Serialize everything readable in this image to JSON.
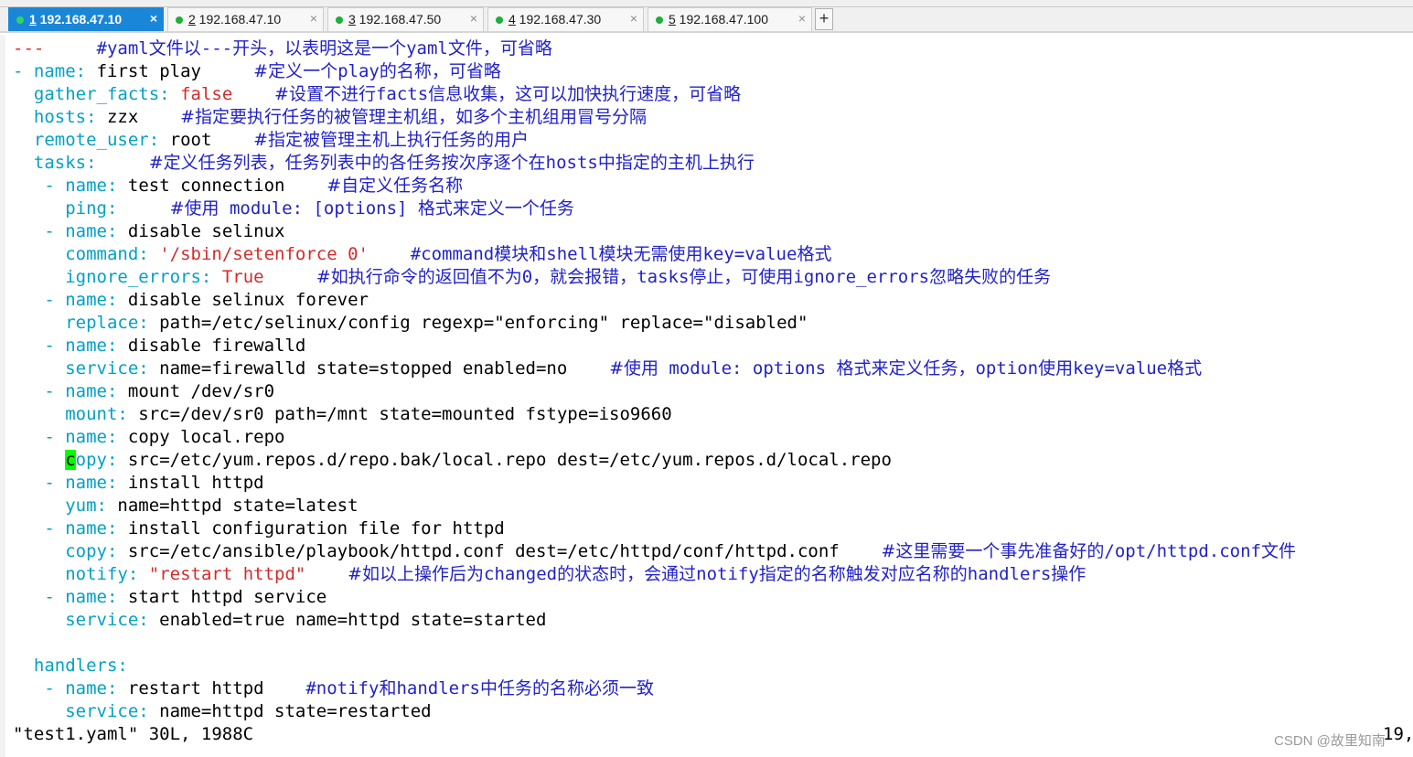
{
  "tabs": [
    {
      "num": "1",
      "host": "192.168.47.10",
      "active": true
    },
    {
      "num": "2",
      "host": "192.168.47.10",
      "active": false
    },
    {
      "num": "3",
      "host": "192.168.47.50",
      "active": false
    },
    {
      "num": "4",
      "host": "192.168.47.30",
      "active": false
    },
    {
      "num": "5",
      "host": "192.168.47.100",
      "active": false
    }
  ],
  "add_tab_label": "+",
  "close_glyph": "×",
  "lines": [
    [
      {
        "t": "---",
        "c": "s"
      },
      {
        "t": "     "
      },
      {
        "t": "#yaml",
        "c": "c"
      },
      {
        "t": "文件以",
        "c": "cz"
      },
      {
        "t": "---",
        "c": "c"
      },
      {
        "t": "开头，以表明这是一个",
        "c": "cz"
      },
      {
        "t": "yaml",
        "c": "c"
      },
      {
        "t": "文件，可省略",
        "c": "cz"
      }
    ],
    [
      {
        "t": "-",
        "c": "d"
      },
      {
        "t": " "
      },
      {
        "t": "name",
        "c": "k"
      },
      {
        "t": ":",
        "c": "d"
      },
      {
        "t": " first play     "
      },
      {
        "t": "#定义一个",
        "c": "cz"
      },
      {
        "t": "play",
        "c": "c"
      },
      {
        "t": "的名称，可省略",
        "c": "cz"
      }
    ],
    [
      {
        "t": "  "
      },
      {
        "t": "gather_facts",
        "c": "k"
      },
      {
        "t": ":",
        "c": "d"
      },
      {
        "t": " "
      },
      {
        "t": "false",
        "c": "s"
      },
      {
        "t": "    "
      },
      {
        "t": "#设置不进行",
        "c": "cz"
      },
      {
        "t": "facts",
        "c": "c"
      },
      {
        "t": "信息收集，这可以加快执行速度，可省略",
        "c": "cz"
      }
    ],
    [
      {
        "t": "  "
      },
      {
        "t": "hosts",
        "c": "k"
      },
      {
        "t": ":",
        "c": "d"
      },
      {
        "t": " zzx    "
      },
      {
        "t": "#指定要执行任务的被管理主机组，如多个主机组用冒号分隔",
        "c": "cz"
      }
    ],
    [
      {
        "t": "  "
      },
      {
        "t": "remote_user",
        "c": "k"
      },
      {
        "t": ":",
        "c": "d"
      },
      {
        "t": " root    "
      },
      {
        "t": "#指定被管理主机上执行任务的用户",
        "c": "cz"
      }
    ],
    [
      {
        "t": "  "
      },
      {
        "t": "tasks",
        "c": "k"
      },
      {
        "t": ":",
        "c": "d"
      },
      {
        "t": "     "
      },
      {
        "t": "#定义任务列表，任务列表中的各任务按次序逐个在",
        "c": "cz"
      },
      {
        "t": "hosts",
        "c": "c"
      },
      {
        "t": "中指定的主机上执行",
        "c": "cz"
      }
    ],
    [
      {
        "t": "   "
      },
      {
        "t": "-",
        "c": "d"
      },
      {
        "t": " "
      },
      {
        "t": "name",
        "c": "k"
      },
      {
        "t": ":",
        "c": "d"
      },
      {
        "t": " test connection    "
      },
      {
        "t": "#自定义任务名称",
        "c": "cz"
      }
    ],
    [
      {
        "t": "     "
      },
      {
        "t": "ping",
        "c": "k"
      },
      {
        "t": ":",
        "c": "d"
      },
      {
        "t": "     "
      },
      {
        "t": "#使用",
        "c": "cz"
      },
      {
        "t": " module: [options] ",
        "c": "c"
      },
      {
        "t": "格式来定义一个任务",
        "c": "cz"
      }
    ],
    [
      {
        "t": "   "
      },
      {
        "t": "-",
        "c": "d"
      },
      {
        "t": " "
      },
      {
        "t": "name",
        "c": "k"
      },
      {
        "t": ":",
        "c": "d"
      },
      {
        "t": " disable selinux"
      }
    ],
    [
      {
        "t": "     "
      },
      {
        "t": "command",
        "c": "k"
      },
      {
        "t": ":",
        "c": "d"
      },
      {
        "t": " "
      },
      {
        "t": "'/sbin/setenforce 0'",
        "c": "s"
      },
      {
        "t": "    "
      },
      {
        "t": "#command",
        "c": "c"
      },
      {
        "t": "模块和",
        "c": "cz"
      },
      {
        "t": "shell",
        "c": "c"
      },
      {
        "t": "模块无需使用",
        "c": "cz"
      },
      {
        "t": "key=value",
        "c": "c"
      },
      {
        "t": "格式",
        "c": "cz"
      }
    ],
    [
      {
        "t": "     "
      },
      {
        "t": "ignore_errors",
        "c": "k"
      },
      {
        "t": ":",
        "c": "d"
      },
      {
        "t": " "
      },
      {
        "t": "True",
        "c": "s"
      },
      {
        "t": "     "
      },
      {
        "t": "#如执行命令的返回值不为",
        "c": "cz"
      },
      {
        "t": "0",
        "c": "c"
      },
      {
        "t": "，就会报错，",
        "c": "cz"
      },
      {
        "t": "tasks",
        "c": "c"
      },
      {
        "t": "停止，可使用",
        "c": "cz"
      },
      {
        "t": "ignore_errors",
        "c": "c"
      },
      {
        "t": "忽略失败的任务",
        "c": "cz"
      }
    ],
    [
      {
        "t": "   "
      },
      {
        "t": "-",
        "c": "d"
      },
      {
        "t": " "
      },
      {
        "t": "name",
        "c": "k"
      },
      {
        "t": ":",
        "c": "d"
      },
      {
        "t": " disable selinux forever"
      }
    ],
    [
      {
        "t": "     "
      },
      {
        "t": "replace",
        "c": "k"
      },
      {
        "t": ":",
        "c": "d"
      },
      {
        "t": " path=/etc/selinux/config regexp=\"enforcing\" replace=\"disabled\""
      }
    ],
    [
      {
        "t": "   "
      },
      {
        "t": "-",
        "c": "d"
      },
      {
        "t": " "
      },
      {
        "t": "name",
        "c": "k"
      },
      {
        "t": ":",
        "c": "d"
      },
      {
        "t": " disable firewalld"
      }
    ],
    [
      {
        "t": "     "
      },
      {
        "t": "service",
        "c": "k"
      },
      {
        "t": ":",
        "c": "d"
      },
      {
        "t": " name=firewalld state=stopped enabled=no    "
      },
      {
        "t": "#使用",
        "c": "cz"
      },
      {
        "t": " module: options ",
        "c": "c"
      },
      {
        "t": "格式来定义任务，",
        "c": "cz"
      },
      {
        "t": "option",
        "c": "c"
      },
      {
        "t": "使用",
        "c": "cz"
      },
      {
        "t": "key=value",
        "c": "c"
      },
      {
        "t": "格式",
        "c": "cz"
      }
    ],
    [
      {
        "t": "   "
      },
      {
        "t": "-",
        "c": "d"
      },
      {
        "t": " "
      },
      {
        "t": "name",
        "c": "k"
      },
      {
        "t": ":",
        "c": "d"
      },
      {
        "t": " mount /dev/sr0"
      }
    ],
    [
      {
        "t": "     "
      },
      {
        "t": "mount",
        "c": "k"
      },
      {
        "t": ":",
        "c": "d"
      },
      {
        "t": " src=/dev/sr0 path=/mnt state=mounted fstype=iso9660"
      }
    ],
    [
      {
        "t": "   "
      },
      {
        "t": "-",
        "c": "d"
      },
      {
        "t": " "
      },
      {
        "t": "name",
        "c": "k"
      },
      {
        "t": ":",
        "c": "d"
      },
      {
        "t": " copy local.repo"
      }
    ],
    [
      {
        "t": "     "
      },
      {
        "t": "c",
        "c": "cur"
      },
      {
        "t": "opy",
        "c": "k"
      },
      {
        "t": ":",
        "c": "d"
      },
      {
        "t": " src=/etc/yum.repos.d/repo.bak/local.repo dest=/etc/yum.repos.d/local.repo"
      }
    ],
    [
      {
        "t": "   "
      },
      {
        "t": "-",
        "c": "d"
      },
      {
        "t": " "
      },
      {
        "t": "name",
        "c": "k"
      },
      {
        "t": ":",
        "c": "d"
      },
      {
        "t": " install httpd"
      }
    ],
    [
      {
        "t": "     "
      },
      {
        "t": "yum",
        "c": "k"
      },
      {
        "t": ":",
        "c": "d"
      },
      {
        "t": " name=httpd state=latest"
      }
    ],
    [
      {
        "t": "   "
      },
      {
        "t": "-",
        "c": "d"
      },
      {
        "t": " "
      },
      {
        "t": "name",
        "c": "k"
      },
      {
        "t": ":",
        "c": "d"
      },
      {
        "t": " install configuration file for httpd"
      }
    ],
    [
      {
        "t": "     "
      },
      {
        "t": "copy",
        "c": "k"
      },
      {
        "t": ":",
        "c": "d"
      },
      {
        "t": " src=/etc/ansible/playbook/httpd.conf dest=/etc/httpd/conf/httpd.conf    "
      },
      {
        "t": "#这里需要一个事先准备好的",
        "c": "cz"
      },
      {
        "t": "/opt/httpd.conf",
        "c": "c"
      },
      {
        "t": "文件",
        "c": "cz"
      }
    ],
    [
      {
        "t": "     "
      },
      {
        "t": "notify",
        "c": "k"
      },
      {
        "t": ":",
        "c": "d"
      },
      {
        "t": " "
      },
      {
        "t": "\"restart httpd\"",
        "c": "s"
      },
      {
        "t": "    "
      },
      {
        "t": "#如以上操作后为",
        "c": "cz"
      },
      {
        "t": "changed",
        "c": "c"
      },
      {
        "t": "的状态时，会通过",
        "c": "cz"
      },
      {
        "t": "notify",
        "c": "c"
      },
      {
        "t": "指定的名称触发对应名称的",
        "c": "cz"
      },
      {
        "t": "handlers",
        "c": "c"
      },
      {
        "t": "操作",
        "c": "cz"
      }
    ],
    [
      {
        "t": "   "
      },
      {
        "t": "-",
        "c": "d"
      },
      {
        "t": " "
      },
      {
        "t": "name",
        "c": "k"
      },
      {
        "t": ":",
        "c": "d"
      },
      {
        "t": " start httpd service"
      }
    ],
    [
      {
        "t": "     "
      },
      {
        "t": "service",
        "c": "k"
      },
      {
        "t": ":",
        "c": "d"
      },
      {
        "t": " enabled=true name=httpd state=started"
      }
    ],
    [
      {
        "t": ""
      }
    ],
    [
      {
        "t": "  "
      },
      {
        "t": "handlers",
        "c": "k"
      },
      {
        "t": ":",
        "c": "d"
      }
    ],
    [
      {
        "t": "   "
      },
      {
        "t": "-",
        "c": "d"
      },
      {
        "t": " "
      },
      {
        "t": "name",
        "c": "k"
      },
      {
        "t": ":",
        "c": "d"
      },
      {
        "t": " restart httpd    "
      },
      {
        "t": "#notify",
        "c": "c"
      },
      {
        "t": "和",
        "c": "cz"
      },
      {
        "t": "handlers",
        "c": "c"
      },
      {
        "t": "中任务的名称必须一致",
        "c": "cz"
      }
    ],
    [
      {
        "t": "     "
      },
      {
        "t": "service",
        "c": "k"
      },
      {
        "t": ":",
        "c": "d"
      },
      {
        "t": " name=httpd state=restarted"
      }
    ]
  ],
  "status_line": "\"test1.yaml\" 30L, 1988C",
  "cursor_position": "19,",
  "watermark": "CSDN @故里知南",
  "colors": {
    "tab_active": "#1a86d8",
    "status_dot": "#1fae3a",
    "yaml_key": "#00a1c4",
    "yaml_string": "#d62a2a",
    "comment": "#2222c8",
    "cursor": "#00ff00"
  }
}
